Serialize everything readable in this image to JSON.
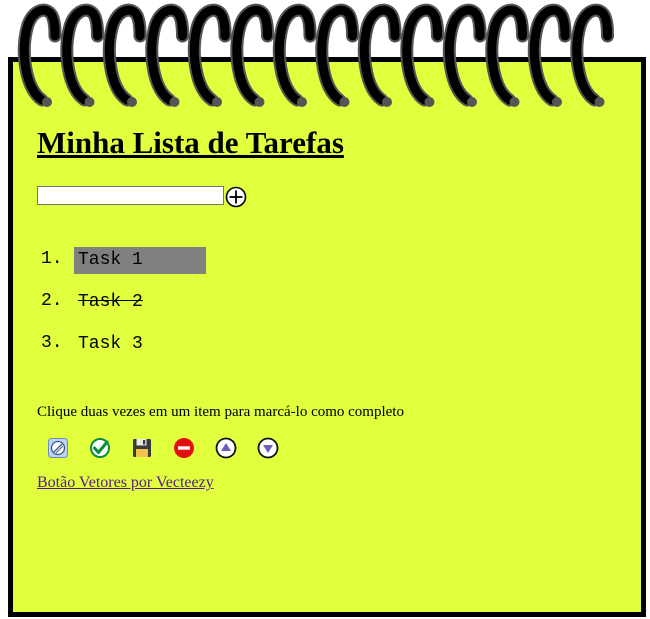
{
  "app": {
    "title": "Minha Lista de Tarefas"
  },
  "input": {
    "value": "",
    "placeholder": ""
  },
  "add_button": {
    "icon": "plus-circle-icon"
  },
  "tasks": [
    {
      "number": "1.",
      "text": "Task 1",
      "selected": true,
      "completed": false
    },
    {
      "number": "2.",
      "text": "Task 2",
      "selected": false,
      "completed": true
    },
    {
      "number": "3.",
      "text": "Task 3",
      "selected": false,
      "completed": false
    }
  ],
  "hint": "Clique duas vezes em um item para marcá-lo como completo",
  "toolbar": [
    {
      "name": "clear-button",
      "icon": "clear-icon"
    },
    {
      "name": "complete-button",
      "icon": "checkmark-icon"
    },
    {
      "name": "save-button",
      "icon": "floppy-disk-icon"
    },
    {
      "name": "remove-button",
      "icon": "minus-circle-icon"
    },
    {
      "name": "move-up-button",
      "icon": "arrow-up-icon"
    },
    {
      "name": "move-down-button",
      "icon": "arrow-down-icon"
    }
  ],
  "credit": {
    "text": "Botão Vetores por Vecteezy"
  },
  "colors": {
    "paper": "#e1ff3d",
    "border": "#000000",
    "selected": "#808080",
    "link": "#551a8b"
  }
}
